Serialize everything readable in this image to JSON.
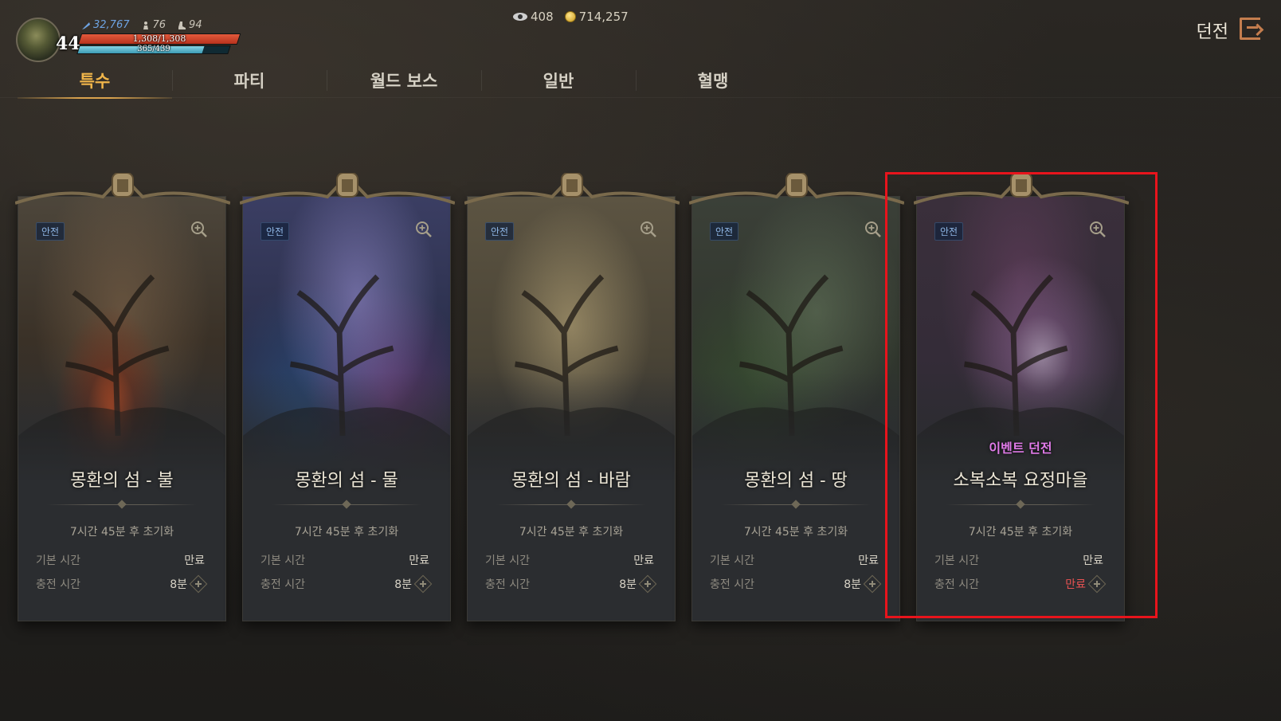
{
  "player": {
    "level": "44",
    "power": "32,767",
    "stat2": "76",
    "stat3": "94",
    "hp": "1,308/1,308",
    "mp": "365/439",
    "hp_fraction": 1.0,
    "mp_fraction": 0.83
  },
  "currency": {
    "gems": "408",
    "gold": "714,257"
  },
  "header": {
    "title": "던전"
  },
  "tabs": [
    {
      "label": "특수",
      "active": true
    },
    {
      "label": "파티",
      "active": false
    },
    {
      "label": "월드 보스",
      "active": false
    },
    {
      "label": "일반",
      "active": false
    },
    {
      "label": "혈맹",
      "active": false
    }
  ],
  "cards": [
    {
      "badge": "안전",
      "event_label": "",
      "title": "몽환의 섬 - 불",
      "reset": "7시간 45분 후 초기화",
      "base_label": "기본 시간",
      "base_value": "만료",
      "charge_label": "충전 시간",
      "charge_value": "8분",
      "theme": "fire"
    },
    {
      "badge": "안전",
      "event_label": "",
      "title": "몽환의 섬 - 물",
      "reset": "7시간 45분 후 초기화",
      "base_label": "기본 시간",
      "base_value": "만료",
      "charge_label": "충전 시간",
      "charge_value": "8분",
      "theme": "water"
    },
    {
      "badge": "안전",
      "event_label": "",
      "title": "몽환의 섬 - 바람",
      "reset": "7시간 45분 후 초기화",
      "base_label": "기본 시간",
      "base_value": "만료",
      "charge_label": "충전 시간",
      "charge_value": "8분",
      "theme": "wind"
    },
    {
      "badge": "안전",
      "event_label": "",
      "title": "몽환의 섬 - 땅",
      "reset": "7시간 45분 후 초기화",
      "base_label": "기본 시간",
      "base_value": "만료",
      "charge_label": "충전 시간",
      "charge_value": "8분",
      "theme": "earth"
    },
    {
      "badge": "안전",
      "event_label": "이벤트 던전",
      "title": "소복소복 요정마을",
      "reset": "7시간 45분 후 초기화",
      "base_label": "기본 시간",
      "base_value": "만료",
      "charge_label": "충전 시간",
      "charge_value": "만료",
      "theme": "fairy"
    }
  ],
  "colors": {
    "accent_tab": "#f0b54a",
    "event_label": "#e07ae8",
    "expired_red": "#e85252",
    "highlight": "#e8141c",
    "badge_text": "#8fb7e6"
  }
}
